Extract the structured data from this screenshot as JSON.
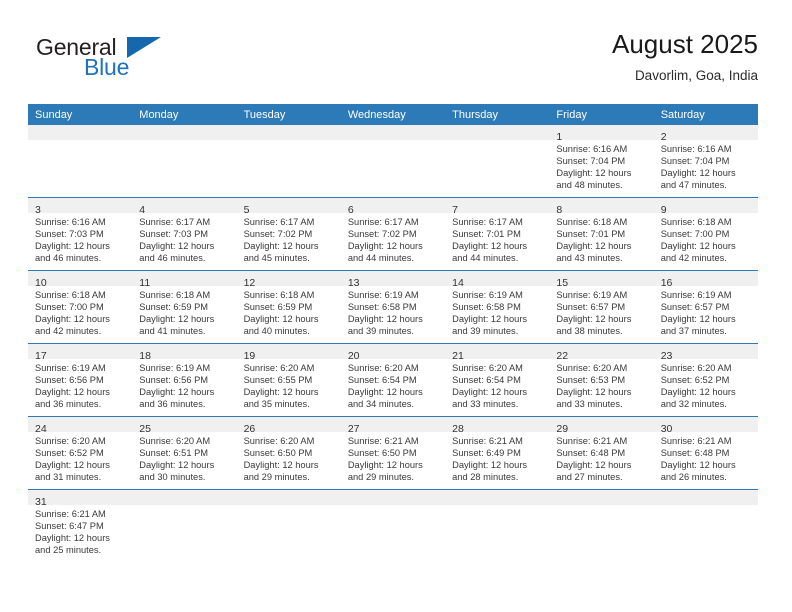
{
  "brand": {
    "name_top": "General",
    "name_bottom": "Blue",
    "flag_icon": "brand-flag-icon",
    "colors": {
      "general": "#231f20",
      "blue": "#1f72bd",
      "flag": "#1668ae"
    }
  },
  "header": {
    "title": "August 2025",
    "subtitle": "Davorlim, Goa, India"
  },
  "theme": {
    "header_row_bg": "#2d7ab8",
    "day_band_bg": "#f0f0f0",
    "grid_line": "#2d7ab8",
    "text": "#333333"
  },
  "calendar": {
    "weekday_headers": [
      "Sunday",
      "Monday",
      "Tuesday",
      "Wednesday",
      "Thursday",
      "Friday",
      "Saturday"
    ],
    "weeks": [
      [
        {
          "empty": true
        },
        {
          "empty": true
        },
        {
          "empty": true
        },
        {
          "empty": true
        },
        {
          "empty": true
        },
        {
          "day": "1",
          "sunrise": "Sunrise: 6:16 AM",
          "sunset": "Sunset: 7:04 PM",
          "daylight_1": "Daylight: 12 hours",
          "daylight_2": "and 48 minutes."
        },
        {
          "day": "2",
          "sunrise": "Sunrise: 6:16 AM",
          "sunset": "Sunset: 7:04 PM",
          "daylight_1": "Daylight: 12 hours",
          "daylight_2": "and 47 minutes."
        }
      ],
      [
        {
          "day": "3",
          "sunrise": "Sunrise: 6:16 AM",
          "sunset": "Sunset: 7:03 PM",
          "daylight_1": "Daylight: 12 hours",
          "daylight_2": "and 46 minutes."
        },
        {
          "day": "4",
          "sunrise": "Sunrise: 6:17 AM",
          "sunset": "Sunset: 7:03 PM",
          "daylight_1": "Daylight: 12 hours",
          "daylight_2": "and 46 minutes."
        },
        {
          "day": "5",
          "sunrise": "Sunrise: 6:17 AM",
          "sunset": "Sunset: 7:02 PM",
          "daylight_1": "Daylight: 12 hours",
          "daylight_2": "and 45 minutes."
        },
        {
          "day": "6",
          "sunrise": "Sunrise: 6:17 AM",
          "sunset": "Sunset: 7:02 PM",
          "daylight_1": "Daylight: 12 hours",
          "daylight_2": "and 44 minutes."
        },
        {
          "day": "7",
          "sunrise": "Sunrise: 6:17 AM",
          "sunset": "Sunset: 7:01 PM",
          "daylight_1": "Daylight: 12 hours",
          "daylight_2": "and 44 minutes."
        },
        {
          "day": "8",
          "sunrise": "Sunrise: 6:18 AM",
          "sunset": "Sunset: 7:01 PM",
          "daylight_1": "Daylight: 12 hours",
          "daylight_2": "and 43 minutes."
        },
        {
          "day": "9",
          "sunrise": "Sunrise: 6:18 AM",
          "sunset": "Sunset: 7:00 PM",
          "daylight_1": "Daylight: 12 hours",
          "daylight_2": "and 42 minutes."
        }
      ],
      [
        {
          "day": "10",
          "sunrise": "Sunrise: 6:18 AM",
          "sunset": "Sunset: 7:00 PM",
          "daylight_1": "Daylight: 12 hours",
          "daylight_2": "and 42 minutes."
        },
        {
          "day": "11",
          "sunrise": "Sunrise: 6:18 AM",
          "sunset": "Sunset: 6:59 PM",
          "daylight_1": "Daylight: 12 hours",
          "daylight_2": "and 41 minutes."
        },
        {
          "day": "12",
          "sunrise": "Sunrise: 6:18 AM",
          "sunset": "Sunset: 6:59 PM",
          "daylight_1": "Daylight: 12 hours",
          "daylight_2": "and 40 minutes."
        },
        {
          "day": "13",
          "sunrise": "Sunrise: 6:19 AM",
          "sunset": "Sunset: 6:58 PM",
          "daylight_1": "Daylight: 12 hours",
          "daylight_2": "and 39 minutes."
        },
        {
          "day": "14",
          "sunrise": "Sunrise: 6:19 AM",
          "sunset": "Sunset: 6:58 PM",
          "daylight_1": "Daylight: 12 hours",
          "daylight_2": "and 39 minutes."
        },
        {
          "day": "15",
          "sunrise": "Sunrise: 6:19 AM",
          "sunset": "Sunset: 6:57 PM",
          "daylight_1": "Daylight: 12 hours",
          "daylight_2": "and 38 minutes."
        },
        {
          "day": "16",
          "sunrise": "Sunrise: 6:19 AM",
          "sunset": "Sunset: 6:57 PM",
          "daylight_1": "Daylight: 12 hours",
          "daylight_2": "and 37 minutes."
        }
      ],
      [
        {
          "day": "17",
          "sunrise": "Sunrise: 6:19 AM",
          "sunset": "Sunset: 6:56 PM",
          "daylight_1": "Daylight: 12 hours",
          "daylight_2": "and 36 minutes."
        },
        {
          "day": "18",
          "sunrise": "Sunrise: 6:19 AM",
          "sunset": "Sunset: 6:56 PM",
          "daylight_1": "Daylight: 12 hours",
          "daylight_2": "and 36 minutes."
        },
        {
          "day": "19",
          "sunrise": "Sunrise: 6:20 AM",
          "sunset": "Sunset: 6:55 PM",
          "daylight_1": "Daylight: 12 hours",
          "daylight_2": "and 35 minutes."
        },
        {
          "day": "20",
          "sunrise": "Sunrise: 6:20 AM",
          "sunset": "Sunset: 6:54 PM",
          "daylight_1": "Daylight: 12 hours",
          "daylight_2": "and 34 minutes."
        },
        {
          "day": "21",
          "sunrise": "Sunrise: 6:20 AM",
          "sunset": "Sunset: 6:54 PM",
          "daylight_1": "Daylight: 12 hours",
          "daylight_2": "and 33 minutes."
        },
        {
          "day": "22",
          "sunrise": "Sunrise: 6:20 AM",
          "sunset": "Sunset: 6:53 PM",
          "daylight_1": "Daylight: 12 hours",
          "daylight_2": "and 33 minutes."
        },
        {
          "day": "23",
          "sunrise": "Sunrise: 6:20 AM",
          "sunset": "Sunset: 6:52 PM",
          "daylight_1": "Daylight: 12 hours",
          "daylight_2": "and 32 minutes."
        }
      ],
      [
        {
          "day": "24",
          "sunrise": "Sunrise: 6:20 AM",
          "sunset": "Sunset: 6:52 PM",
          "daylight_1": "Daylight: 12 hours",
          "daylight_2": "and 31 minutes."
        },
        {
          "day": "25",
          "sunrise": "Sunrise: 6:20 AM",
          "sunset": "Sunset: 6:51 PM",
          "daylight_1": "Daylight: 12 hours",
          "daylight_2": "and 30 minutes."
        },
        {
          "day": "26",
          "sunrise": "Sunrise: 6:20 AM",
          "sunset": "Sunset: 6:50 PM",
          "daylight_1": "Daylight: 12 hours",
          "daylight_2": "and 29 minutes."
        },
        {
          "day": "27",
          "sunrise": "Sunrise: 6:21 AM",
          "sunset": "Sunset: 6:50 PM",
          "daylight_1": "Daylight: 12 hours",
          "daylight_2": "and 29 minutes."
        },
        {
          "day": "28",
          "sunrise": "Sunrise: 6:21 AM",
          "sunset": "Sunset: 6:49 PM",
          "daylight_1": "Daylight: 12 hours",
          "daylight_2": "and 28 minutes."
        },
        {
          "day": "29",
          "sunrise": "Sunrise: 6:21 AM",
          "sunset": "Sunset: 6:48 PM",
          "daylight_1": "Daylight: 12 hours",
          "daylight_2": "and 27 minutes."
        },
        {
          "day": "30",
          "sunrise": "Sunrise: 6:21 AM",
          "sunset": "Sunset: 6:48 PM",
          "daylight_1": "Daylight: 12 hours",
          "daylight_2": "and 26 minutes."
        }
      ],
      [
        {
          "day": "31",
          "sunrise": "Sunrise: 6:21 AM",
          "sunset": "Sunset: 6:47 PM",
          "daylight_1": "Daylight: 12 hours",
          "daylight_2": "and 25 minutes."
        },
        {
          "empty": true
        },
        {
          "empty": true
        },
        {
          "empty": true
        },
        {
          "empty": true
        },
        {
          "empty": true
        },
        {
          "empty": true
        }
      ]
    ]
  }
}
